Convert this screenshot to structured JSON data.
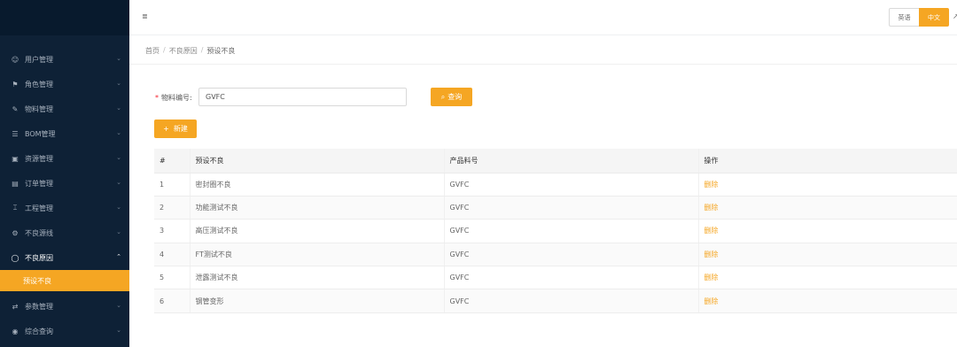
{
  "sidebar": {
    "items": [
      {
        "label": "用户管理",
        "icon": "user-icon"
      },
      {
        "label": "角色管理",
        "icon": "role-icon"
      },
      {
        "label": "物料管理",
        "icon": "edit-icon"
      },
      {
        "label": "BOM管理",
        "icon": "list-icon"
      },
      {
        "label": "资源管理",
        "icon": "resource-icon"
      },
      {
        "label": "订单管理",
        "icon": "order-icon"
      },
      {
        "label": "工程管理",
        "icon": "engineering-icon"
      },
      {
        "label": "不良源线",
        "icon": "gear-icon"
      },
      {
        "label": "不良原因",
        "icon": "bell-icon"
      }
    ],
    "submenu": [
      {
        "label": "预设不良"
      }
    ],
    "items_after": [
      {
        "label": "参数管理",
        "icon": "parameter-icon"
      },
      {
        "label": "综合查询",
        "icon": "globe-icon"
      }
    ]
  },
  "header": {
    "fold_icon": "menu-fold-icon",
    "languages": [
      "英语",
      "中文"
    ],
    "active_language": "中文"
  },
  "breadcrumb": [
    "首页",
    "不良原因",
    "预设不良"
  ],
  "search": {
    "label": "物料编号:",
    "value": "GVFC",
    "button_label": "查询"
  },
  "toolbar": {
    "add_label": "新建"
  },
  "table": {
    "headers": [
      "#",
      "预设不良",
      "产品料号",
      "操作"
    ],
    "rows": [
      {
        "idx": "1",
        "defect": "密封圈不良",
        "material": "GVFC",
        "action": "删除"
      },
      {
        "idx": "2",
        "defect": "功能测试不良",
        "material": "GVFC",
        "action": "删除"
      },
      {
        "idx": "3",
        "defect": "高压测试不良",
        "material": "GVFC",
        "action": "删除"
      },
      {
        "idx": "4",
        "defect": "FT测试不良",
        "material": "GVFC",
        "action": "删除"
      },
      {
        "idx": "5",
        "defect": "泄露测试不良",
        "material": "GVFC",
        "action": "删除"
      },
      {
        "idx": "6",
        "defect": "钢管变形",
        "material": "GVFC",
        "action": "删除"
      }
    ]
  },
  "colors": {
    "accent": "#f5a623",
    "sidebar_bg": "#0e2136",
    "danger": "#f5222d"
  }
}
